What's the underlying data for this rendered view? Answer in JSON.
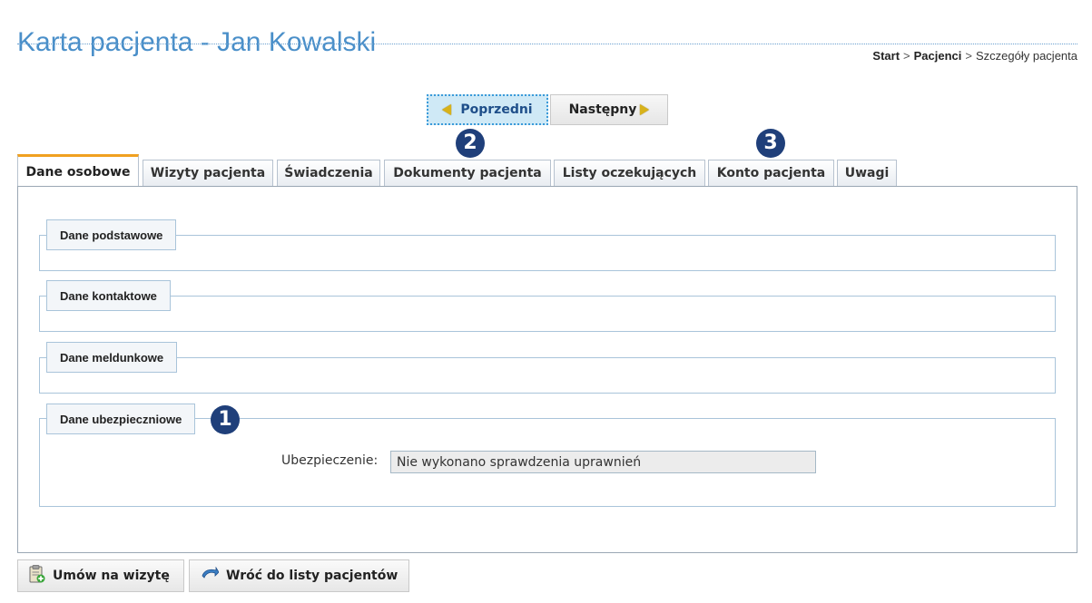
{
  "header": {
    "title": "Karta pacjenta - Jan Kowalski"
  },
  "breadcrumb": {
    "items": [
      "Start",
      "Pacjenci",
      "Szczegóły pacjenta"
    ],
    "separator": ">"
  },
  "navigation": {
    "prev_label": "Poprzedni",
    "next_label": "Następny"
  },
  "badges": [
    "1",
    "2",
    "3"
  ],
  "tabs": [
    {
      "label": "Dane osobowe",
      "active": true
    },
    {
      "label": "Wizyty pacjenta",
      "active": false
    },
    {
      "label": "Świadczenia",
      "active": false
    },
    {
      "label": "Dokumenty pacjenta",
      "active": false
    },
    {
      "label": "Listy oczekujących",
      "active": false
    },
    {
      "label": "Konto pacjenta",
      "active": false
    },
    {
      "label": "Uwagi",
      "active": false
    }
  ],
  "sections": [
    {
      "title": "Dane podstawowe"
    },
    {
      "title": "Dane kontaktowe"
    },
    {
      "title": "Dane meldunkowe"
    },
    {
      "title": "Dane ubezpieczniowe"
    }
  ],
  "insurance": {
    "label": "Ubezpieczenie:",
    "value": "Nie wykonano sprawdzenia uprawnień"
  },
  "actions": {
    "appoint_label": "Umów na wizytę",
    "back_label": "Wróć do listy pacjentów"
  },
  "icons": {
    "prev": "arrow-left-icon",
    "next": "arrow-right-icon",
    "appoint": "clipboard-add-icon",
    "back": "back-arrow-icon"
  },
  "colors": {
    "title": "#4a8fc9",
    "badge": "#1f3f7a",
    "active_tab_accent": "#f0a020",
    "prev_highlight": "#cfe9f6"
  }
}
